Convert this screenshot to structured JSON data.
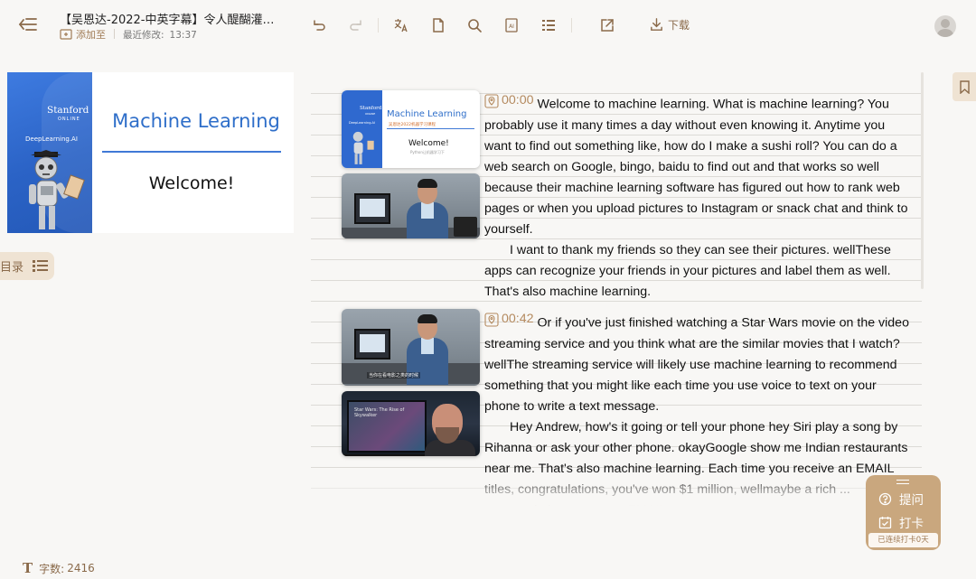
{
  "header": {
    "doc_title": "【吴恩达-2022-中英字幕】令人醍醐灌…",
    "add_to_label": "添加至",
    "modified_label": "最近修改:",
    "modified_time": "13:37",
    "download_label": "下载"
  },
  "toolbar": {
    "icons": [
      "undo-icon",
      "redo-icon",
      "translate-icon",
      "file-icon",
      "search-icon",
      "ai-icon",
      "outline-icon",
      "export-icon",
      "download-icon"
    ]
  },
  "cover": {
    "university": "Stanford",
    "online": "ONLINE",
    "brand": "DeepLearning.AI",
    "title": "Machine Learning",
    "welcome": "Welcome!"
  },
  "sidebar": {
    "toc_label": "目录",
    "word_count_label": "字数:",
    "word_count": "2416"
  },
  "segments": [
    {
      "timestamp": "00:00",
      "thumb_slide": {
        "university": "Stanford",
        "online": "ONLINE",
        "brand": "DeepLearning.AI",
        "title": "Machine Learning",
        "subtitle": "吴恩达2022机器学习课程",
        "welcome": "Welcome!",
        "welcome_sub": "Python让机器学习下"
      },
      "paragraphs": [
        "Welcome to machine learning. What is machine learning? You probably use it many times a day without even knowing it. Anytime you want to find out something like, how do I make a sushi roll? You can do a web search on Google, bingo, baidu to find out and that works so well because their machine learning software has figured out how to rank web pages or when you upload pictures to Instagram or snack chat and think to yourself.",
        "I want to thank my friends so they can see their pictures. wellThese apps can recognize your friends in your pictures and label them as well. That's also machine learning."
      ]
    },
    {
      "timestamp": "00:42",
      "thumb_caption": "当你在看电影之类的时候",
      "tv_caption": "Star Wars: The Rise of Skywalker",
      "paragraphs": [
        "Or if you've just finished watching a Star Wars movie on the video streaming service and you think what are the similar movies that I watch? wellThe streaming service will likely use machine learning to recommend something that you might like each time you use voice to text on your phone to write a text message.",
        "Hey Andrew, how's it going or tell your phone hey Siri play a song by Rihanna or ask your other phone. okayGoogle show me Indian restaurants near me. That's also machine learning. Each time you receive an EMAIL titles, congratulations, you've won $1 million, wellmaybe a rich ... congratulations ... you ... EMAIL ... ..."
      ]
    }
  ],
  "float_panel": {
    "ask_label": "提问",
    "checkin_label": "打卡",
    "streak_label": "已连续打卡0天"
  },
  "colors": {
    "accent": "#8a6a4a",
    "timestamp": "#b48a5f",
    "panel": "#c9a77e",
    "tab_bg": "#efe3d3",
    "slide_blue": "#2e6ec9"
  }
}
